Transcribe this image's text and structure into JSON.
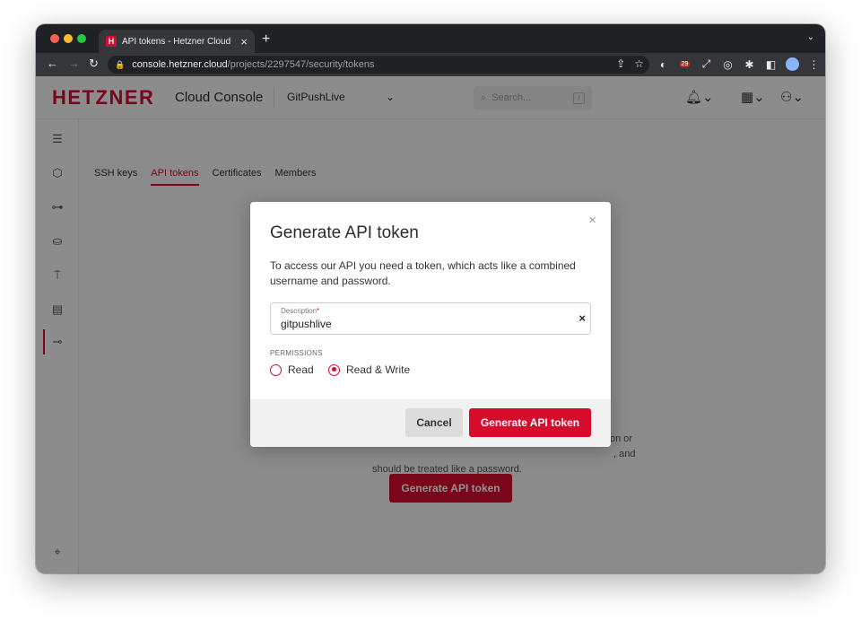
{
  "browser": {
    "tab_favicon": "H",
    "tab_title": "API tokens - Hetzner Cloud",
    "tab_close": "×",
    "new_tab": "+",
    "tab_menu": "⌄",
    "url_domain": "console.hetzner.cloud",
    "url_path": "/projects/2297547/security/tokens",
    "ext_badge": "29"
  },
  "topnav": {
    "logo": "HETZNER",
    "product": "Cloud Console",
    "project": "GitPushLive",
    "search_placeholder": "Search...",
    "search_key": "/"
  },
  "subnav": {
    "tabs": [
      "SSH keys",
      "API tokens",
      "Certificates",
      "Members"
    ],
    "active_tab": "API tokens"
  },
  "background": {
    "text_line1": "on or",
    "text_line2": ", and",
    "text_line3": "should be treated like a password.",
    "generate_button": "Generate API token"
  },
  "modal": {
    "title": "Generate API token",
    "close": "×",
    "description": "To access our API you need a token, which acts like a combined username and password.",
    "field_label": "Description",
    "field_required": "*",
    "field_value": "gitpushlive",
    "field_clear": "×",
    "permissions_heading": "PERMISSIONS",
    "permissions": [
      {
        "label": "Read",
        "checked": false
      },
      {
        "label": "Read & Write",
        "checked": true
      }
    ],
    "cancel_label": "Cancel",
    "generate_label": "Generate API token"
  },
  "colors": {
    "brand": "#d50c2d",
    "overlay": "rgba(0,0,0,0.43)"
  }
}
